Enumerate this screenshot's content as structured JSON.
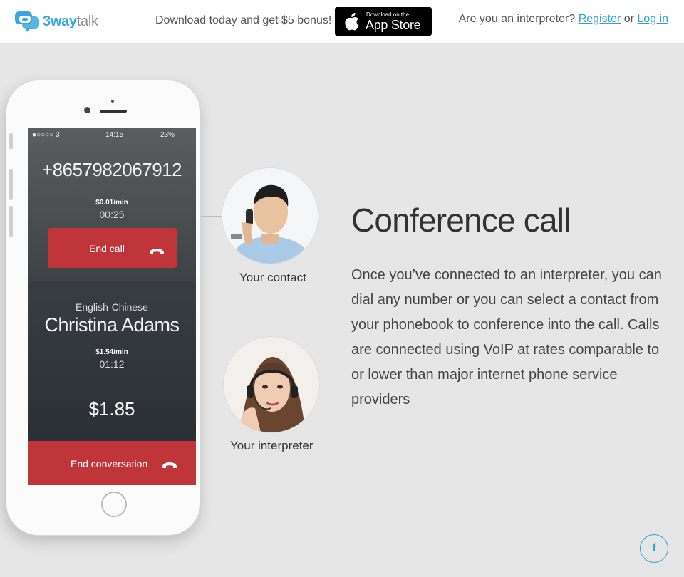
{
  "header": {
    "logo": {
      "part1": "3way",
      "part2": "talk"
    },
    "promo_text": "Download today and get $5 bonus!",
    "appstore": {
      "small_text": "Download on the",
      "big_text": "App Store"
    },
    "auth": {
      "question": "Are you an interpreter?",
      "register_label": "Register",
      "or_text": "or",
      "login_label": "Log in"
    }
  },
  "phone": {
    "status": {
      "signal": "●○○○○ 3",
      "time": "14:15",
      "battery": "23%"
    },
    "number": "+8657982067912",
    "contact_rate": "$0.01/min",
    "contact_duration": "00:25",
    "end_call_label": "End call",
    "language_pair": "English-Chinese",
    "interpreter_name": "Christina Adams",
    "interpreter_rate": "$1.54/min",
    "interpreter_duration": "01:12",
    "total_cost": "$1.85",
    "end_conversation_label": "End conversation"
  },
  "participants": {
    "contact_caption": "Your contact",
    "interpreter_caption": "Your interpreter"
  },
  "content": {
    "heading": "Conference call",
    "description": "Once you’ve connected to an interpreter, you can dial any number or you can select a contact from your phonebook to conference into the call. Calls are connected using VoIP at rates comparable to or lower than major internet phone service providers"
  },
  "social": {
    "facebook_icon": "f"
  },
  "colors": {
    "accent": "#2ea3db",
    "end_call_red": "#c0353a",
    "background": "#e6e6e6"
  }
}
